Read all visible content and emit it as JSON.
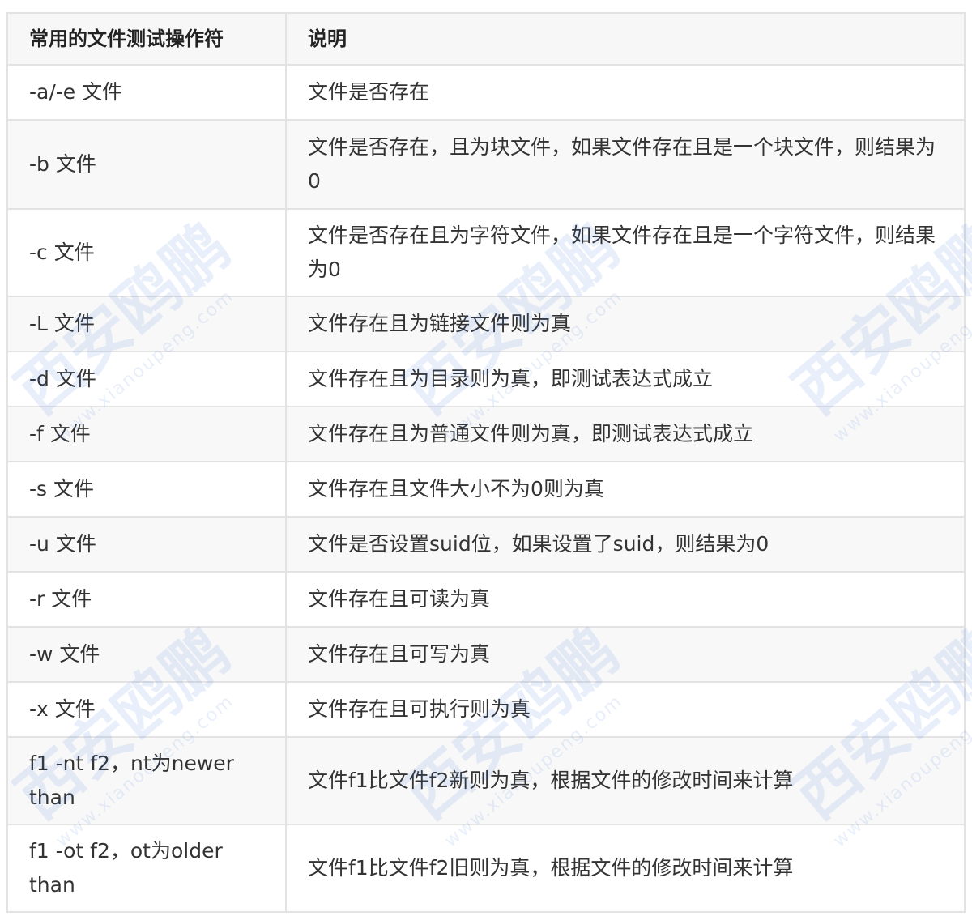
{
  "table": {
    "headers": [
      "常用的文件测试操作符",
      "说明"
    ],
    "rows": [
      {
        "op": "-a/-e 文件",
        "desc": "文件是否存在"
      },
      {
        "op": "-b 文件",
        "desc": "文件是否存在，且为块文件，如果文件存在且是一个块文件，则结果为0"
      },
      {
        "op": "-c 文件",
        "desc": "文件是否存在且为字符文件，如果文件存在且是一个字符文件，则结果为0"
      },
      {
        "op": "-L 文件",
        "desc": "文件存在且为链接文件则为真"
      },
      {
        "op": "-d 文件",
        "desc": "文件存在且为目录则为真，即测试表达式成立"
      },
      {
        "op": "-f 文件",
        "desc": "文件存在且为普通文件则为真，即测试表达式成立"
      },
      {
        "op": "-s 文件",
        "desc": "文件存在且文件大小不为0则为真"
      },
      {
        "op": "-u 文件",
        "desc": "文件是否设置suid位，如果设置了suid，则结果为0"
      },
      {
        "op": "-r 文件",
        "desc": "文件存在且可读为真"
      },
      {
        "op": "-w 文件",
        "desc": "文件存在且可写为真"
      },
      {
        "op": "-x 文件",
        "desc": "文件存在且可执行则为真"
      },
      {
        "op": "f1 -nt f2，nt为newer than",
        "desc": "文件f1比文件f2新则为真，根据文件的修改时间来计算"
      },
      {
        "op": "f1 -ot f2，ot为older than",
        "desc": "文件f1比文件f2旧则为真，根据文件的修改时间来计算"
      }
    ]
  },
  "watermark": {
    "brand": "西安鸥鹏",
    "url": "www.xianoupeng.com"
  }
}
